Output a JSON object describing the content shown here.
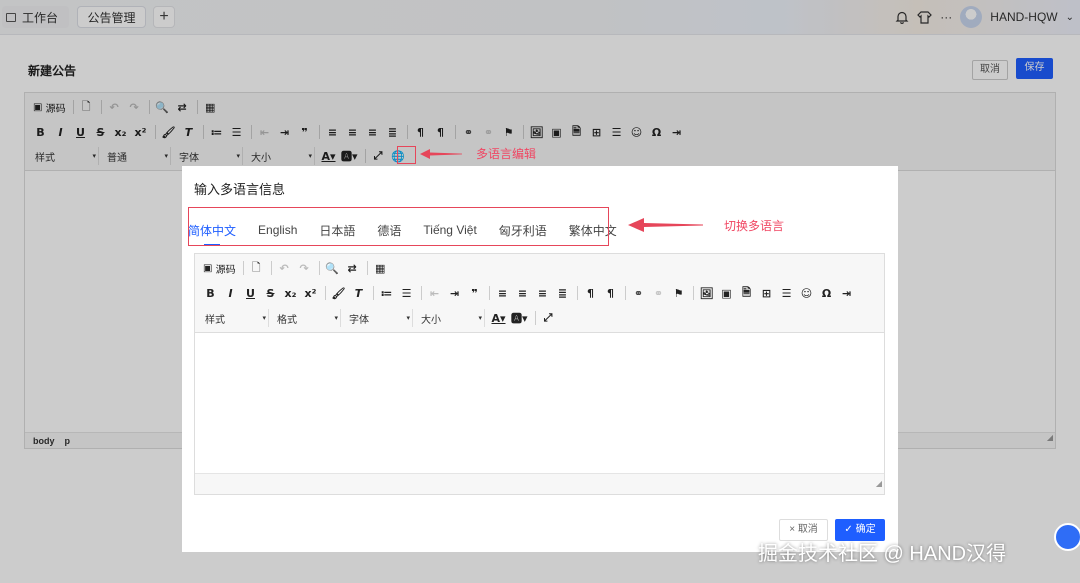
{
  "header": {
    "tab_workbench": "工作台",
    "tab_announcement": "公告管理",
    "add_tab": "+",
    "user_name": "HAND-HQW",
    "more": "···",
    "dropdown": "⌄"
  },
  "page": {
    "title": "新建公告",
    "cancel_label": "取消",
    "save_label": "保存"
  },
  "editor": {
    "source_label": "源码",
    "style_select": "样式",
    "format_select": "普通",
    "font_select": "字体",
    "size_select": "大小",
    "status_body": "body",
    "status_p": "p"
  },
  "dialog": {
    "title": "输入多语言信息",
    "languages": [
      "简体中文",
      "English",
      "日本語",
      "德语",
      "Tiếng Việt",
      "匈牙利语",
      "繁体中文"
    ],
    "active_language": "简体中文",
    "editor": {
      "source_label": "源码",
      "style_select": "样式",
      "format_select": "格式",
      "font_select": "字体",
      "size_select": "大小"
    },
    "cancel_label": "取消",
    "confirm_label": "确定",
    "cancel_icon": "×",
    "confirm_icon": "✓"
  },
  "annotations": {
    "multilang_edit": "多语言编辑",
    "switch_language": "切换多语言"
  },
  "watermark": "掘金技术社区 @ HAND汉得",
  "colors": {
    "primary": "#1e5eff",
    "annotation_red": "#e6465a"
  }
}
